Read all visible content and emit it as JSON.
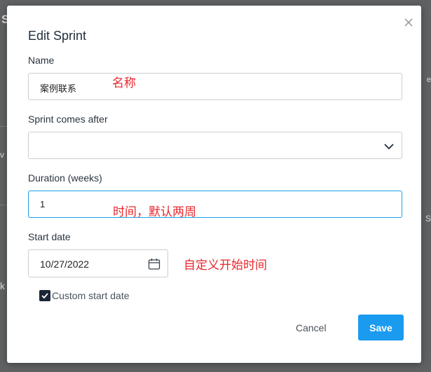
{
  "background": {
    "frag_s": "S",
    "frag_k": "k",
    "frag_v": "v",
    "frag_r1": "e",
    "frag_r2": "S"
  },
  "dialog": {
    "title": "Edit Sprint",
    "name_label": "Name",
    "name_value": "案例联系",
    "name_annotation": "名称",
    "after_label": "Sprint comes after",
    "after_value": "",
    "duration_label": "Duration (weeks)",
    "duration_value": "1",
    "duration_annotation": "时间，默认两周",
    "start_label": "Start date",
    "start_value": "10/27/2022",
    "start_annotation": "自定义开始时间",
    "custom_start_label": "Custom start date",
    "custom_start_checked": true,
    "cancel_label": "Cancel",
    "save_label": "Save"
  },
  "colors": {
    "accent": "#1a9bf0",
    "focus_border": "#1aa1e6",
    "annotation": "#e8272c",
    "overlay": "#5f6163"
  },
  "icons": {
    "close": "close-icon",
    "dropdown": "chevron-down-icon",
    "calendar": "calendar-icon",
    "check": "checkmark-icon"
  }
}
